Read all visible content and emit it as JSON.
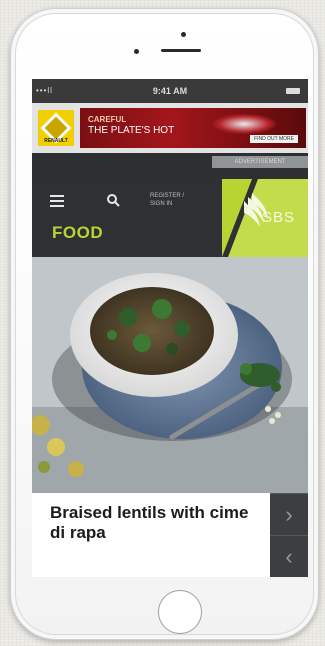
{
  "status_bar": {
    "signal": "•••ll",
    "time": "9:41 AM"
  },
  "ad": {
    "brand": "RENAULT",
    "headline_line1": "CAREFUL",
    "headline_line2": "THE PLATE'S HOT",
    "cta": "FIND OUT MORE",
    "advert_label": "ADVERTISEMENT"
  },
  "nav": {
    "register_line1": "REGISTER /",
    "register_line2": "SIGN IN",
    "section_title": "FOOD",
    "logo_text": "SBS"
  },
  "article": {
    "title": "Braised lentils with cime di rapa"
  },
  "colors": {
    "brand_green": "#b8d434",
    "nav_bg": "#2e3133",
    "ad_red": "#a3161b"
  },
  "icons": {
    "menu": "hamburger-icon",
    "search": "search-icon",
    "next": "chevron-right-icon",
    "prev": "chevron-left-icon"
  }
}
